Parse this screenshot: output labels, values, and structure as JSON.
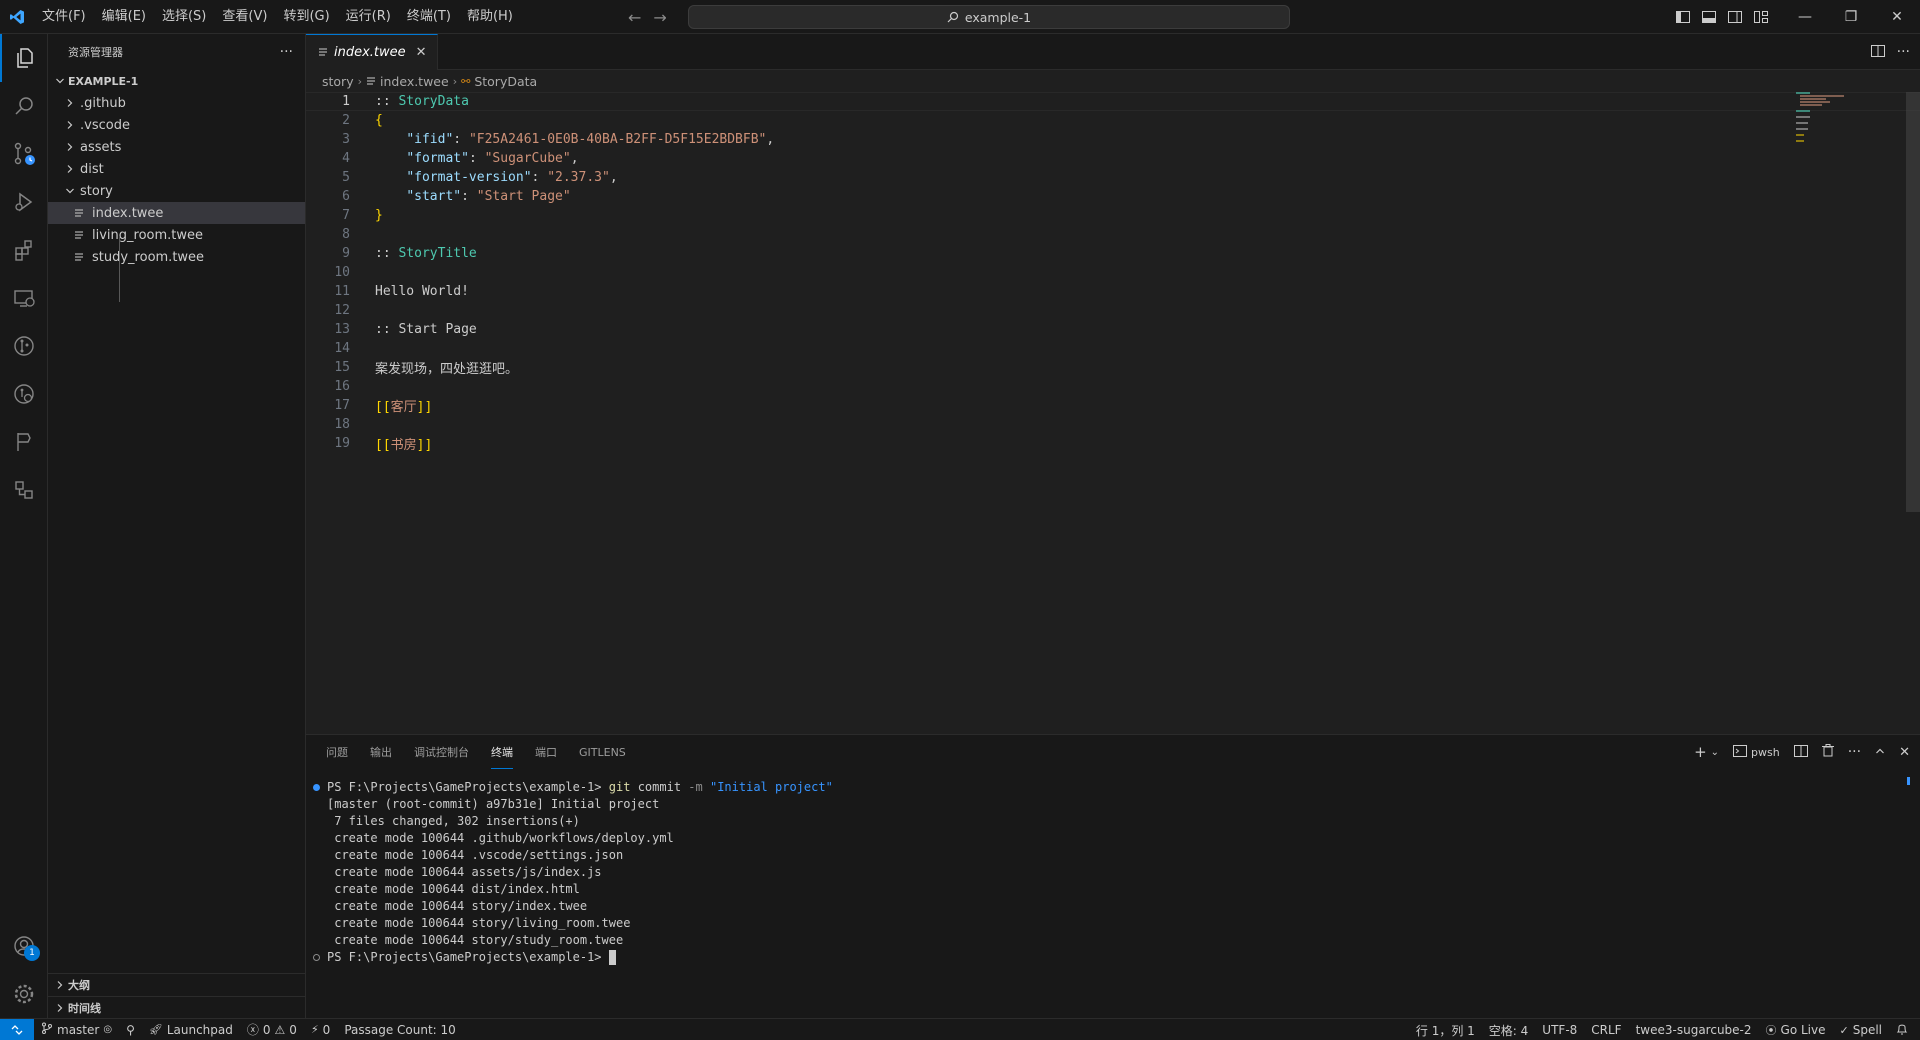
{
  "titlebar": {
    "menu": [
      "文件(F)",
      "编辑(E)",
      "选择(S)",
      "查看(V)",
      "转到(G)",
      "运行(R)",
      "终端(T)",
      "帮助(H)"
    ],
    "search": "example-1"
  },
  "activity_bar": {
    "items": [
      "explorer-icon",
      "search-icon",
      "source-control-icon",
      "run-debug-icon",
      "extensions-icon",
      "remote-explorer-icon",
      "gitlens-icon",
      "gitlens-inspect-icon",
      "git-graph-icon",
      "pull-requests-icon"
    ],
    "accounts_badge": "1"
  },
  "sidebar": {
    "title": "资源管理器",
    "more": "···",
    "folder": "EXAMPLE-1",
    "tree": [
      {
        "label": ".github",
        "type": "folder"
      },
      {
        "label": ".vscode",
        "type": "folder"
      },
      {
        "label": "assets",
        "type": "folder"
      },
      {
        "label": "dist",
        "type": "folder"
      },
      {
        "label": "story",
        "type": "folder-open"
      },
      {
        "label": "index.twee",
        "type": "file",
        "selected": true
      },
      {
        "label": "living_room.twee",
        "type": "file"
      },
      {
        "label": "study_room.twee",
        "type": "file"
      }
    ],
    "outline": "大纲",
    "timeline": "时间线"
  },
  "editor": {
    "tab": "index.twee",
    "breadcrumbs": [
      "story",
      "index.twee",
      "StoryData"
    ],
    "active_line": 1,
    "lines": [
      [
        {
          "t": ":: ",
          "c": "punc"
        },
        {
          "t": "StoryData",
          "c": "name"
        }
      ],
      [
        {
          "t": "{",
          "c": "brace"
        }
      ],
      [
        {
          "t": "    ",
          "c": "punc"
        },
        {
          "t": "\"ifid\"",
          "c": "key"
        },
        {
          "t": ": ",
          "c": "punc"
        },
        {
          "t": "\"F25A2461-0E0B-40BA-B2FF-D5F15E2BDBFB\"",
          "c": "str"
        },
        {
          "t": ",",
          "c": "punc"
        }
      ],
      [
        {
          "t": "    ",
          "c": "punc"
        },
        {
          "t": "\"format\"",
          "c": "key"
        },
        {
          "t": ": ",
          "c": "punc"
        },
        {
          "t": "\"SugarCube\"",
          "c": "str"
        },
        {
          "t": ",",
          "c": "punc"
        }
      ],
      [
        {
          "t": "    ",
          "c": "punc"
        },
        {
          "t": "\"format-version\"",
          "c": "key"
        },
        {
          "t": ": ",
          "c": "punc"
        },
        {
          "t": "\"2.37.3\"",
          "c": "str"
        },
        {
          "t": ",",
          "c": "punc"
        }
      ],
      [
        {
          "t": "    ",
          "c": "punc"
        },
        {
          "t": "\"start\"",
          "c": "key"
        },
        {
          "t": ": ",
          "c": "punc"
        },
        {
          "t": "\"Start Page\"",
          "c": "str"
        }
      ],
      [
        {
          "t": "}",
          "c": "brace"
        }
      ],
      [],
      [
        {
          "t": ":: ",
          "c": "punc"
        },
        {
          "t": "StoryTitle",
          "c": "name"
        }
      ],
      [],
      [
        {
          "t": "Hello World!",
          "c": "punc"
        }
      ],
      [],
      [
        {
          "t": ":: ",
          "c": "punc"
        },
        {
          "t": "Start Page",
          "c": "punc"
        }
      ],
      [],
      [
        {
          "t": "案发现场，四处逛逛吧。",
          "c": "punc"
        }
      ],
      [],
      [
        {
          "t": "[[",
          "c": "link"
        },
        {
          "t": "客厅",
          "c": "linktxt"
        },
        {
          "t": "]]",
          "c": "link"
        }
      ],
      [],
      [
        {
          "t": "[[",
          "c": "link"
        },
        {
          "t": "书房",
          "c": "linktxt"
        },
        {
          "t": "]]",
          "c": "link"
        }
      ]
    ]
  },
  "panel": {
    "tabs": [
      "问题",
      "输出",
      "调试控制台",
      "终端",
      "端口",
      "GITLENS"
    ],
    "active_tab": "终端",
    "shell": "pwsh",
    "terminal": {
      "prompt": "PS F:\\Projects\\GameProjects\\example-1>",
      "command_git": "git",
      "command_sub": "commit",
      "command_flag": "-m",
      "command_msg": "\"Initial project\"",
      "output": [
        "[master (root-commit) a97b31e] Initial project",
        " 7 files changed, 302 insertions(+)",
        " create mode 100644 .github/workflows/deploy.yml",
        " create mode 100644 .vscode/settings.json",
        " create mode 100644 assets/js/index.js",
        " create mode 100644 dist/index.html",
        " create mode 100644 story/index.twee",
        " create mode 100644 story/living_room.twee",
        " create mode 100644 story/study_room.twee"
      ]
    }
  },
  "statusbar": {
    "branch": "master",
    "launchpad": "Launchpad",
    "errors": "0",
    "warnings": "0",
    "ports": "0",
    "passage_count": "Passage Count: 10",
    "position": "行 1，列 1",
    "spaces": "空格: 4",
    "encoding": "UTF-8",
    "eol": "CRLF",
    "language": "twee3-sugarcube-2",
    "golive": "Go Live",
    "spell": "Spell"
  },
  "colors": {
    "accent": "#0078d4",
    "background": "#1f1f1f",
    "sidebar": "#181818"
  }
}
